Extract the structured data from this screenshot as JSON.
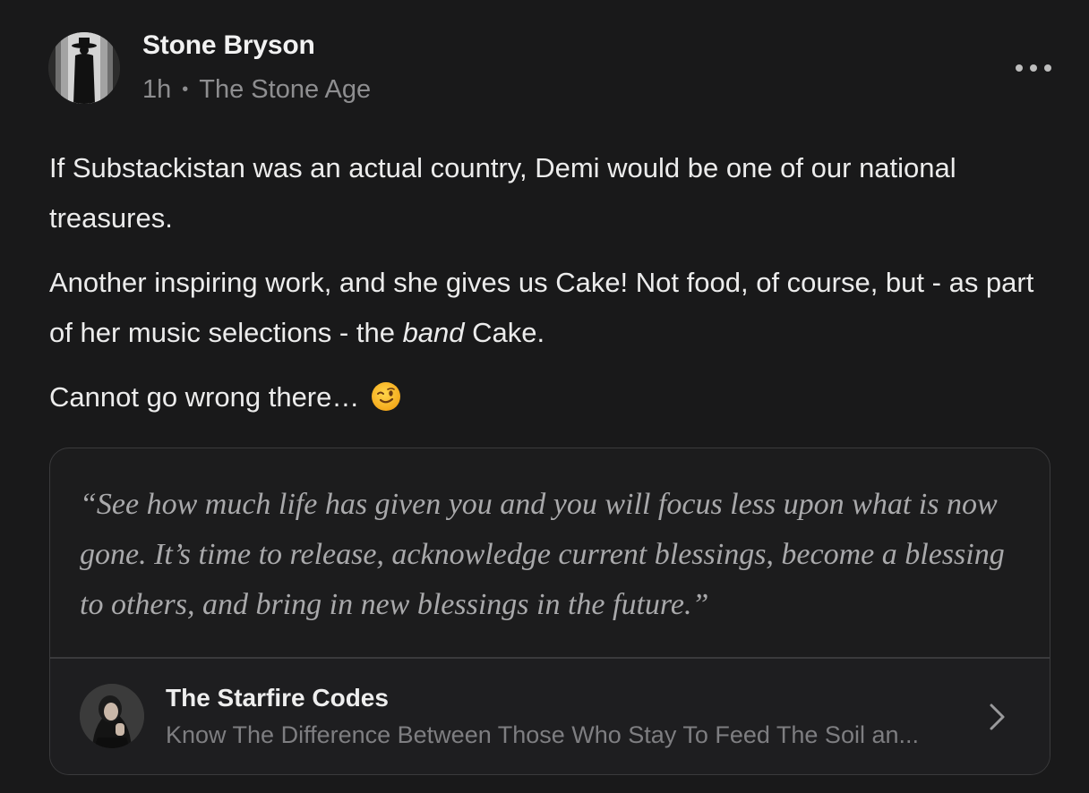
{
  "post": {
    "author": "Stone Bryson",
    "time": "1h",
    "separator": "•",
    "publication": "The Stone Age",
    "paragraph1": "If Substackistan was an actual country, Demi would be one of our national treasures.",
    "paragraph2_before": "Another inspiring work, and she gives us Cake! Not food, of course, but - as part of her music selections - the ",
    "paragraph2_em": "band",
    "paragraph2_after": " Cake.",
    "paragraph3": "Cannot go wrong there…",
    "emoji": "winking-face-icon"
  },
  "quote_card": {
    "quote": "“See how much life has given you and you will focus less upon what is now gone. It’s time to release, acknowledge current blessings, become a blessing to others, and bring in new blessings in the future.”",
    "source_title": "The Starfire Codes",
    "source_subtitle": "Know The Difference Between Those Who Stay To Feed The Soil an..."
  },
  "icons": [
    "more-options-icon",
    "winking-face-icon",
    "chevron-right-icon"
  ],
  "colors": {
    "background": "#19191a",
    "text": "#ececec",
    "muted": "#8e8e90",
    "border": "#3a3a3c"
  }
}
